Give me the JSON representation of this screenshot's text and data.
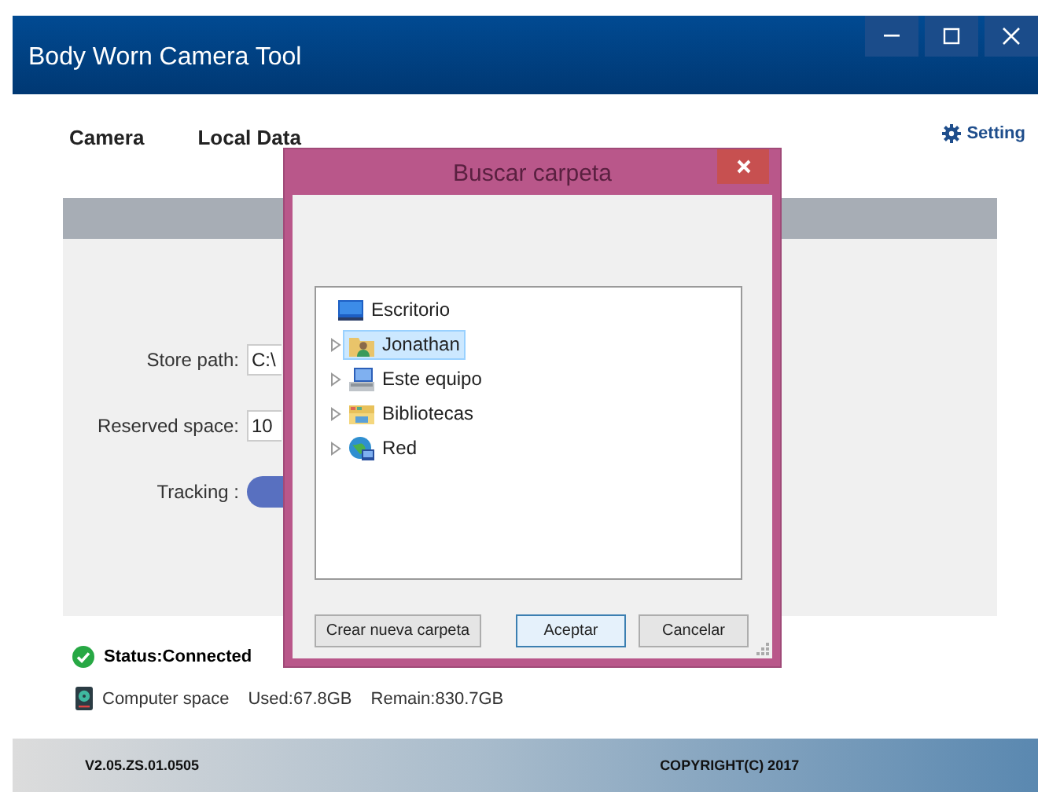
{
  "window": {
    "title": "Body Worn Camera Tool"
  },
  "nav": [
    {
      "label": "Camera"
    },
    {
      "label": "Local Data"
    }
  ],
  "setting": {
    "label": "Setting"
  },
  "form": [
    {
      "kind": "field",
      "label": "Store path:",
      "value": "C:\\"
    },
    {
      "kind": "field",
      "label": "Reserved space:",
      "value": "10"
    },
    {
      "kind": "toggle",
      "label": "Tracking :",
      "on": true
    }
  ],
  "status": {
    "text": "Status:Connected",
    "connected": true
  },
  "space": {
    "label": "Computer space",
    "used": "Used:67.8GB",
    "remain": "Remain:830.7GB"
  },
  "footer": {
    "version": "V2.05.ZS.01.0505",
    "copyright": "COPYRIGHT(C) 2017"
  },
  "dialog": {
    "title": "Buscar carpeta",
    "tree": {
      "label": "Escritorio",
      "kind": "desktop",
      "selected": false,
      "children": [
        {
          "label": "Jonathan",
          "kind": "user",
          "selected": true,
          "expanded": false
        },
        {
          "label": "Este equipo",
          "kind": "computer",
          "selected": false,
          "expanded": false
        },
        {
          "label": "Bibliotecas",
          "kind": "library",
          "selected": false,
          "expanded": false
        },
        {
          "label": "Red",
          "kind": "network",
          "selected": false,
          "expanded": false
        }
      ]
    },
    "buttons": [
      {
        "label": "Crear nueva carpeta",
        "default": false
      },
      {
        "label": "Aceptar",
        "default": true
      },
      {
        "label": "Cancelar",
        "default": false
      }
    ]
  }
}
